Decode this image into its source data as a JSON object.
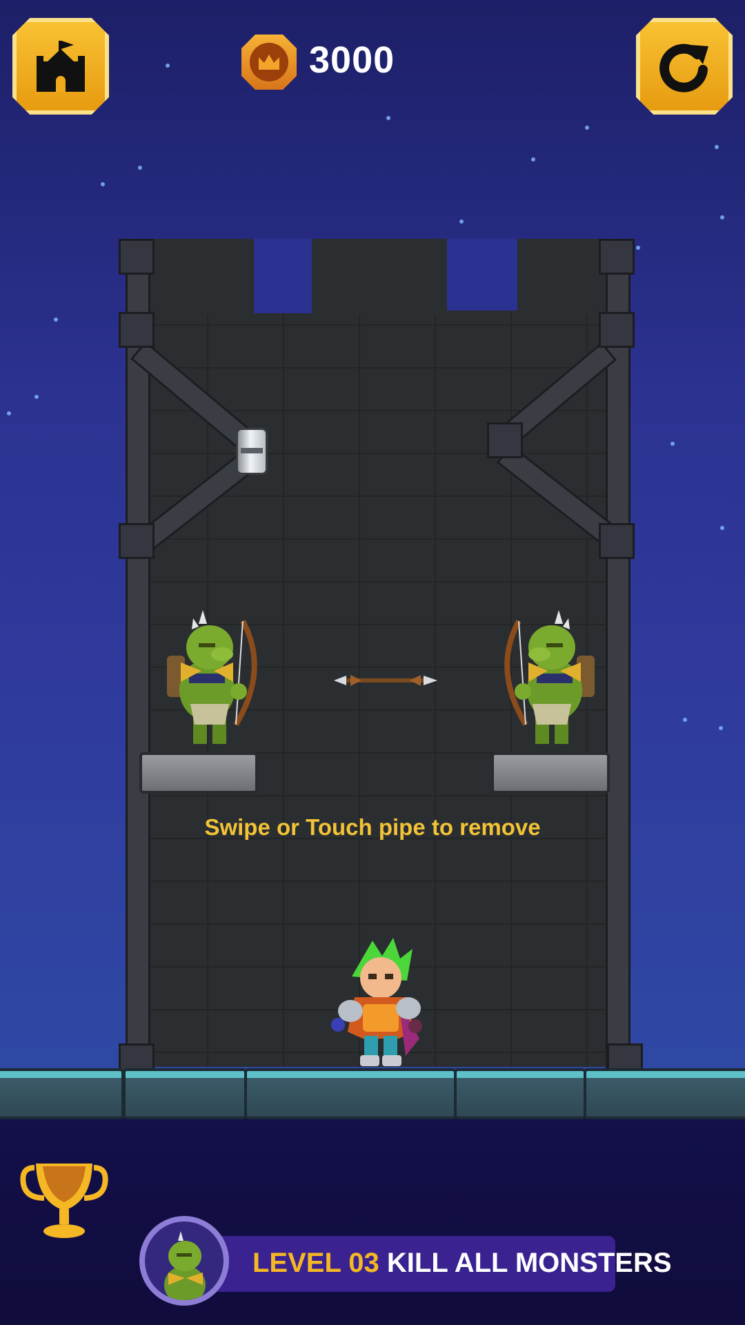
{
  "hud": {
    "coins": "3000",
    "home_icon": "castle-icon",
    "restart_icon": "restart-icon",
    "coin_icon": "crown-coin-icon"
  },
  "puzzle": {
    "hint": "Swipe or Touch pipe to remove"
  },
  "level": {
    "label": "LEVEL 03",
    "objective": "KILL ALL MONSTERS"
  },
  "colors": {
    "accent_gold": "#f5b723",
    "hint_yellow": "#f2c337",
    "panel_purple": "#3a2391"
  }
}
